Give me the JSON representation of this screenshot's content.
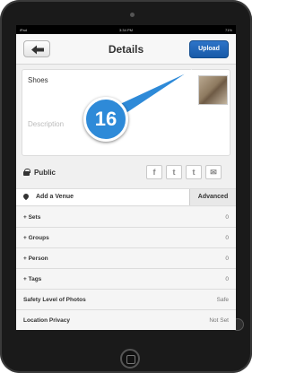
{
  "status_bar": {
    "left": "iPad",
    "time": "3:34 PM",
    "right": "71%"
  },
  "nav": {
    "title": "Details",
    "upload_label": "Upload"
  },
  "photo": {
    "title": "Shoes",
    "description_placeholder": "Description"
  },
  "badge": {
    "number": "16"
  },
  "privacy": {
    "label": "Public"
  },
  "share": {
    "icons": [
      "facebook-icon",
      "twitter-icon",
      "tumblr-icon",
      "email-icon"
    ],
    "glyphs": [
      "f",
      "t",
      "t",
      "✉"
    ]
  },
  "venue": {
    "label": "Add a Venue",
    "advanced_label": "Advanced"
  },
  "list": [
    {
      "label": "+ Sets",
      "value": "0"
    },
    {
      "label": "+ Groups",
      "value": "0"
    },
    {
      "label": "+ Person",
      "value": "0"
    },
    {
      "label": "+ Tags",
      "value": "0"
    },
    {
      "label": "Safety Level of Photos",
      "value": "Safe"
    },
    {
      "label": "Location Privacy",
      "value": "Not Set"
    }
  ],
  "colors": {
    "upload": "#185aa8",
    "badge": "#2e8ad8"
  }
}
